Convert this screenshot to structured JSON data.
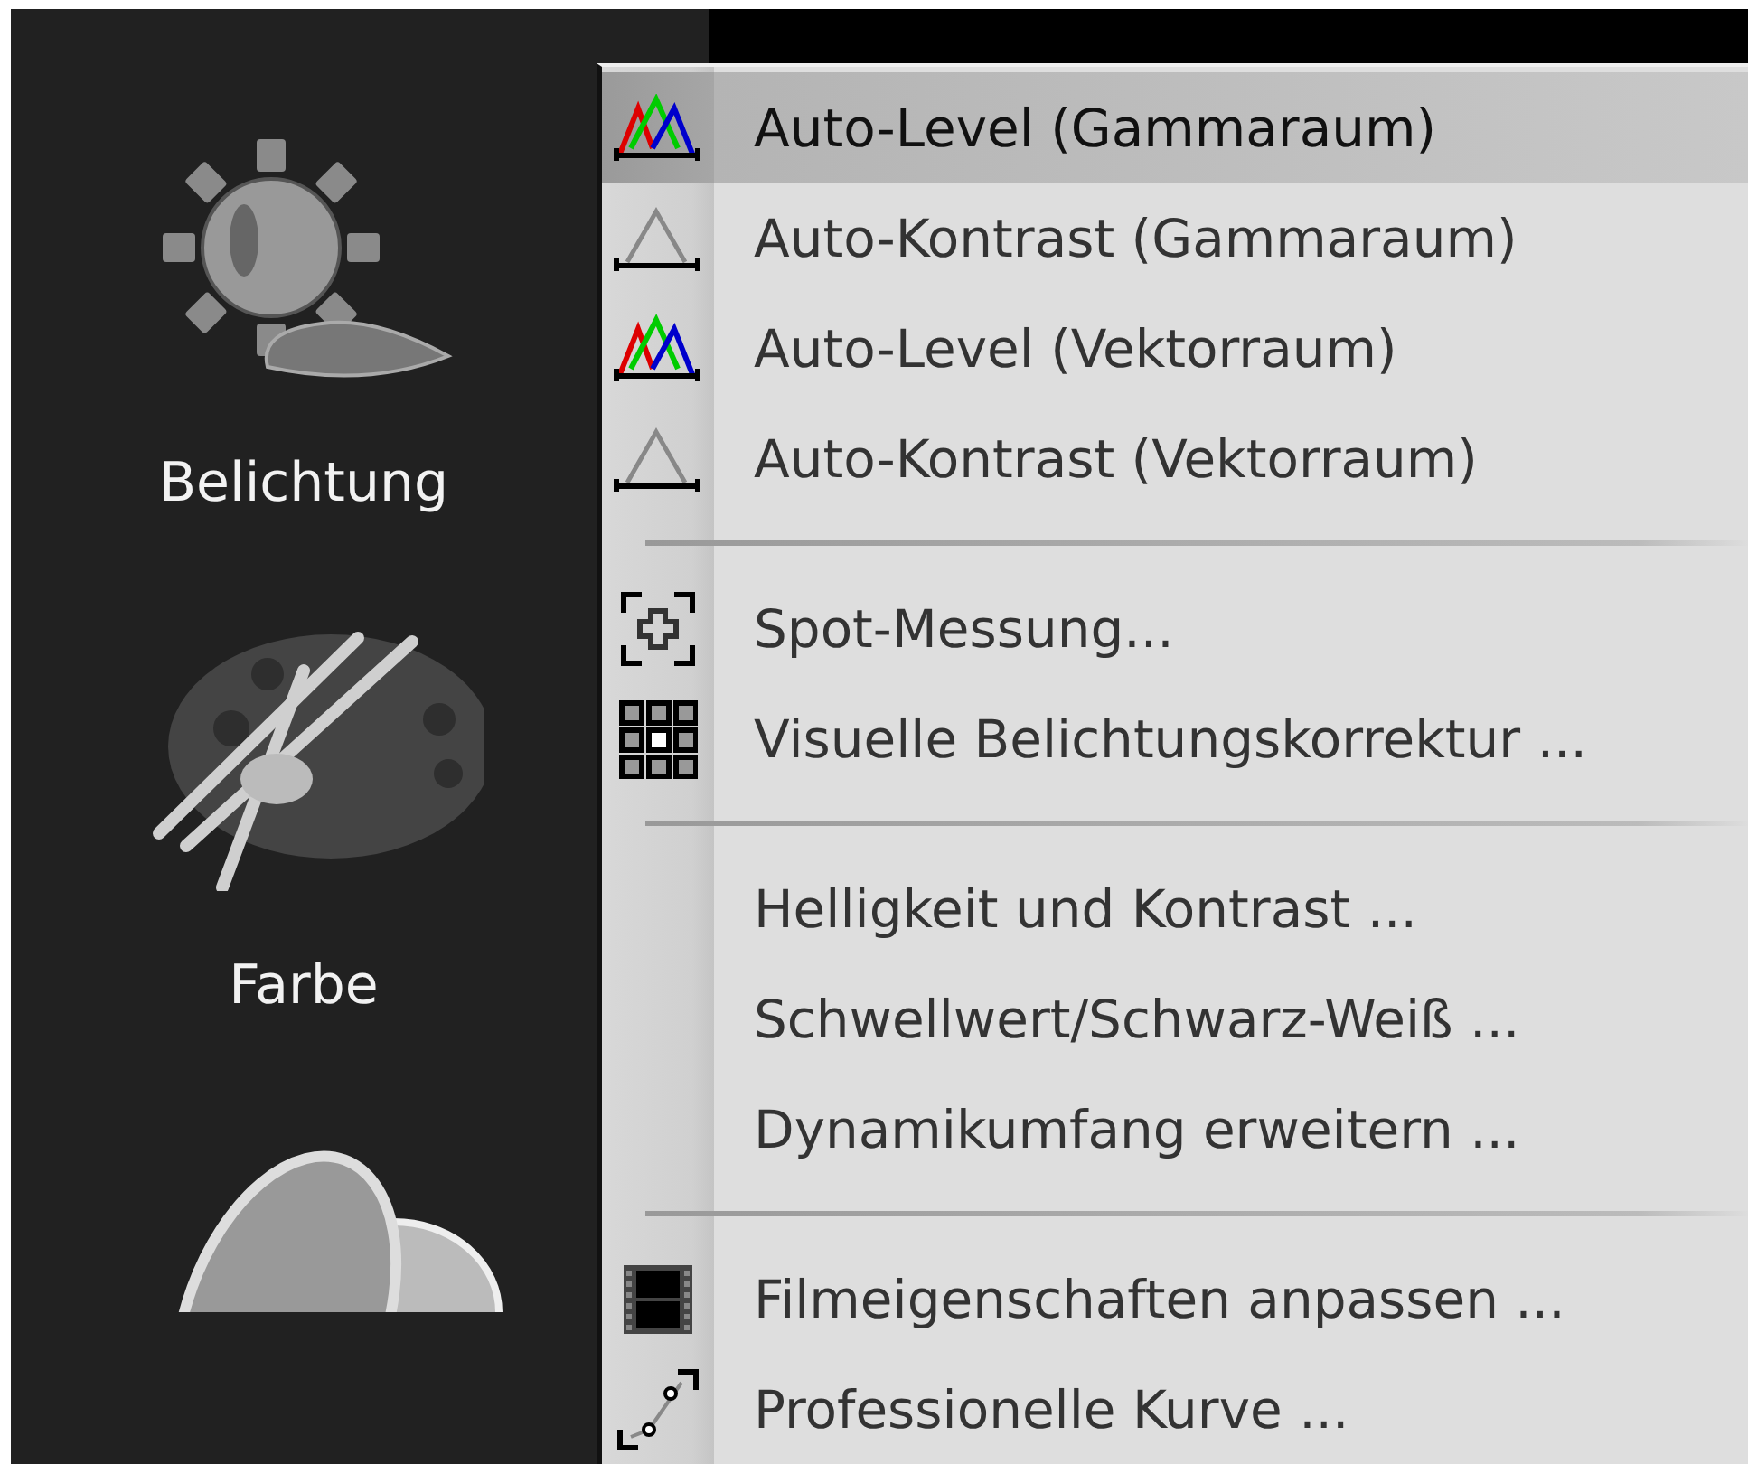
{
  "sidebar": {
    "tools": [
      {
        "label": "Belichtung"
      },
      {
        "label": "Farbe"
      }
    ]
  },
  "menu": {
    "items": [
      {
        "kind": "item",
        "label": "Auto-Level (Gammaraum)",
        "selected": true
      },
      {
        "kind": "item",
        "label": "Auto-Kontrast (Gammaraum)",
        "selected": false
      },
      {
        "kind": "item",
        "label": "Auto-Level (Vektorraum)",
        "selected": false
      },
      {
        "kind": "item",
        "label": "Auto-Kontrast (Vektorraum)",
        "selected": false
      },
      {
        "kind": "separator"
      },
      {
        "kind": "item",
        "label": "Spot-Messung...",
        "selected": false
      },
      {
        "kind": "item",
        "label": "Visuelle Belichtungskorrektur ...",
        "selected": false
      },
      {
        "kind": "separator"
      },
      {
        "kind": "item",
        "label": "Helligkeit und Kontrast ...",
        "selected": false
      },
      {
        "kind": "item",
        "label": "Schwellwert/Schwarz-Weiß ...",
        "selected": false
      },
      {
        "kind": "item",
        "label": "Dynamikumfang erweitern ...",
        "selected": false
      },
      {
        "kind": "separator"
      },
      {
        "kind": "item",
        "label": "Filmeigenschaften anpassen ...",
        "selected": false
      },
      {
        "kind": "item",
        "label": "Professionelle Kurve ...",
        "selected": false
      }
    ]
  }
}
